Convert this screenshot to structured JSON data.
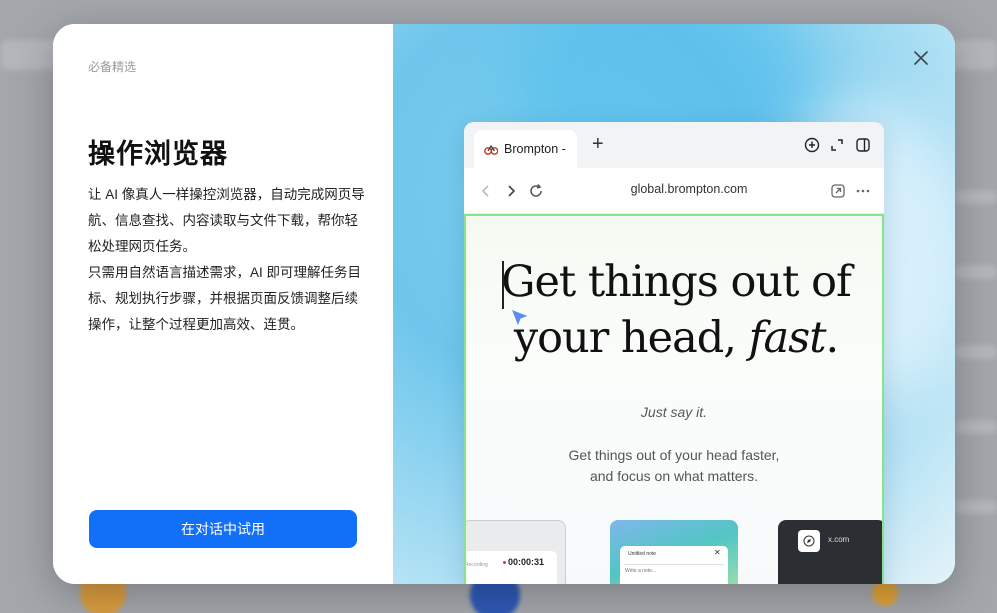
{
  "modal": {
    "eyebrow": "必备精选",
    "title": "操作浏览器",
    "description": [
      "让 AI 像真人一样操控浏览器，自动完成网页导航、信息查找、内容读取与文件下载，帮你轻松处理网页任务。",
      "只需用自然语言描述需求，AI 即可理解任务目标、规划执行步骤，并根据页面反馈调整后续操作，让整个过程更加高效、连贯。"
    ],
    "cta_label": "在对话中试用",
    "close_icon": "close-icon"
  },
  "browser": {
    "tab_title": "Brompton -",
    "url": "global.brompton.com",
    "icons": [
      "back-icon",
      "forward-icon",
      "reload-icon",
      "new-tab-icon",
      "download-icon",
      "fullscreen-icon",
      "sidebar-toggle-icon",
      "share-icon",
      "more-icon"
    ]
  },
  "webpage": {
    "headline_line1": "Get things out of",
    "headline_line2_plain": "your head, ",
    "headline_line2_italic": "fast",
    "headline_period": ".",
    "tagline": "Just say it.",
    "subtext_line1": "Get things out of your head faster,",
    "subtext_line2": "and focus on what matters.",
    "card1_label": "Recording",
    "card1_time": "00:00:31",
    "card2_title": "Untitled note",
    "card2_close": "✕",
    "card2_placeholder": "Write a note...",
    "card3_site": "x.com"
  },
  "colors": {
    "accent": "#1170f7",
    "highlight_border": "#8ae28a"
  }
}
